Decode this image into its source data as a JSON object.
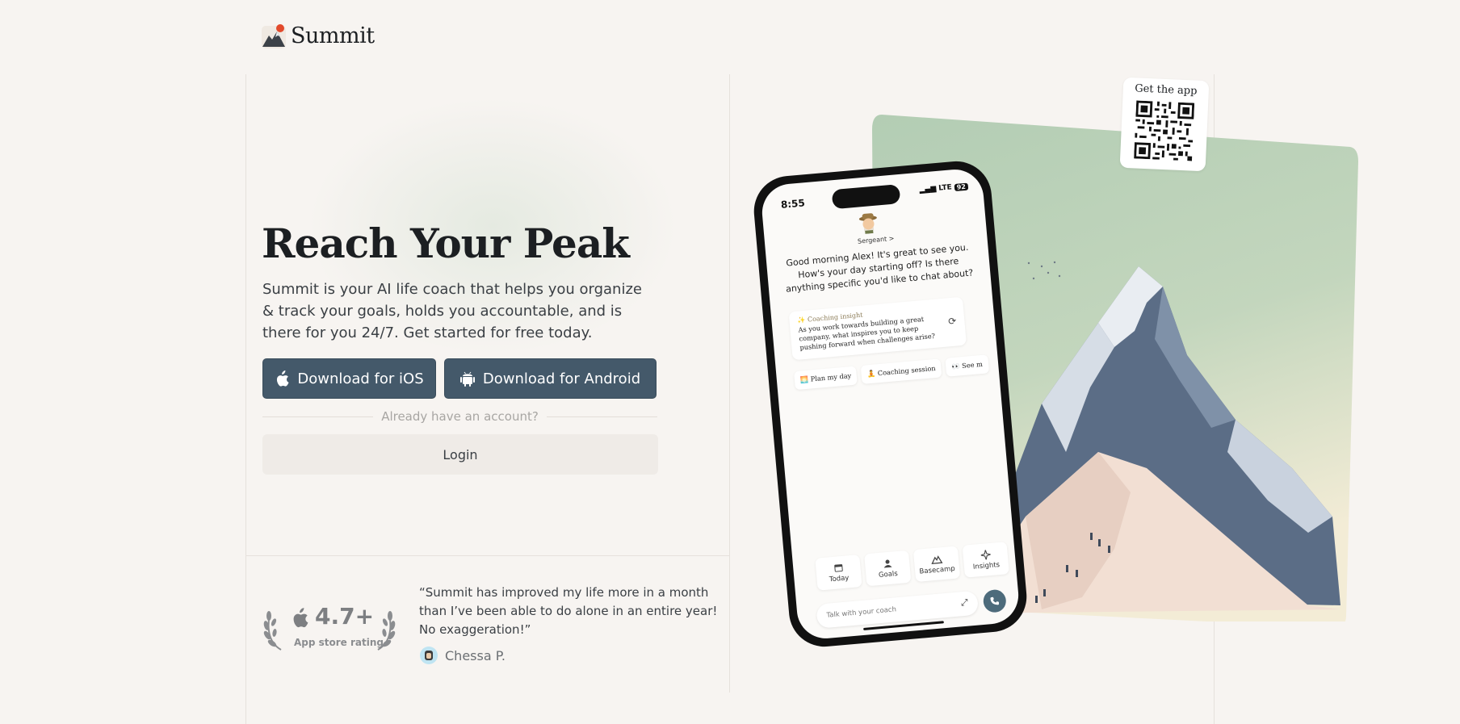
{
  "brand": {
    "name": "Summit"
  },
  "hero": {
    "title": "Reach Your Peak",
    "subtitle": "Summit is your AI life coach that helps you organize & track your goals, holds you accountable, and is there for you 24/7. Get started for free today."
  },
  "buttons": {
    "ios": "Download for iOS",
    "android": "Download for Android",
    "account_prompt": "Already have an account?",
    "login": "Login"
  },
  "rating": {
    "score": "4.7+",
    "label": "App store rating"
  },
  "testimonial": {
    "quote": "“Summit has improved my life more in a month than I’ve been able to do alone in an entire year! No exaggeration!”",
    "author": "Chessa P."
  },
  "qr": {
    "label": "Get the app"
  },
  "phone": {
    "time": "8:55",
    "network": "LTE",
    "battery": "92",
    "coach_name": "Sergeant >",
    "greeting": "Good morning Alex! It's great to see you. How's your day starting off? Is there anything specific you'd like to chat about?",
    "insight_title": "✨ Coaching insight",
    "insight_body": "As you work towards building a great company, what inspires you to keep pushing forward when challenges arise?",
    "chips": [
      "🌅 Plan my day",
      "🧘 Coaching session",
      "👀 See m"
    ],
    "tabs": [
      "Today",
      "Goals",
      "Basecamp",
      "Insights"
    ],
    "chat_placeholder": "Talk with your coach"
  },
  "colors": {
    "background": "#f7f4f1",
    "button": "#44596a",
    "card_green": "#b3cdb4",
    "card_cream": "#f3ecd6"
  }
}
